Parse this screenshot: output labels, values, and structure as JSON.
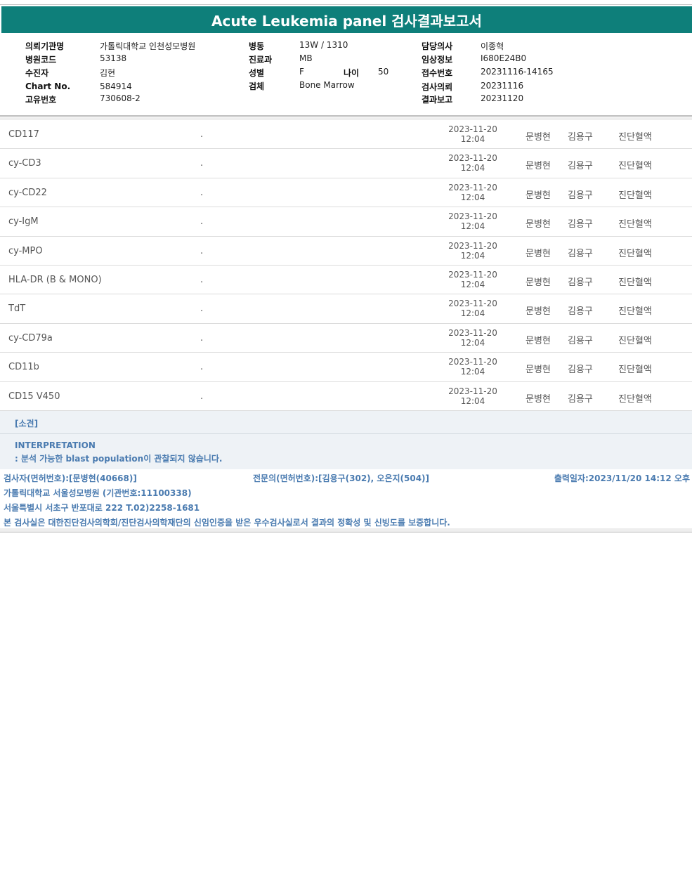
{
  "report": {
    "title": "Acute Leukemia panel 검사결과보고서"
  },
  "patient_info": {
    "institution_label": "의뢰기관명",
    "institution": "가톨릭대학교 인천성모병원",
    "hospital_code_label": "병원코드",
    "hospital_code": "53138",
    "patient_label": "수진자",
    "patient": "김현",
    "chart_no_label": "Chart No.",
    "chart_no": "584914",
    "unique_no_label": "고유번호",
    "unique_no": "730608-2",
    "ward_label": "병동",
    "ward": "13W / 1310",
    "department_label": "진료과",
    "department": "MB",
    "sex_label": "성별",
    "sex": "F",
    "age_label": "나이",
    "age": "50",
    "specimen_label": "검체",
    "specimen": "Bone Marrow",
    "doctor_label": "담당의사",
    "doctor": "이종혁",
    "clinical_info_label": "임상정보",
    "clinical_info": "I680E24B0",
    "receipt_no_label": "접수번호",
    "receipt_no": "20231116-14165",
    "request_date_label": "검사의뢰",
    "request_date": "20231116",
    "report_date_label": "결과보고",
    "report_date": "20231120"
  },
  "results": [
    {
      "name": "CD117",
      "value": ".",
      "date": "2023-11-20",
      "time": "12:04",
      "tester": "문병현",
      "specialist": "김용구",
      "dept": "진단혈액"
    },
    {
      "name": "cy-CD3",
      "value": ".",
      "date": "2023-11-20",
      "time": "12:04",
      "tester": "문병현",
      "specialist": "김용구",
      "dept": "진단혈액"
    },
    {
      "name": "cy-CD22",
      "value": ".",
      "date": "2023-11-20",
      "time": "12:04",
      "tester": "문병현",
      "specialist": "김용구",
      "dept": "진단혈액"
    },
    {
      "name": "cy-IgM",
      "value": ".",
      "date": "2023-11-20",
      "time": "12:04",
      "tester": "문병현",
      "specialist": "김용구",
      "dept": "진단혈액"
    },
    {
      "name": "cy-MPO",
      "value": ".",
      "date": "2023-11-20",
      "time": "12:04",
      "tester": "문병현",
      "specialist": "김용구",
      "dept": "진단혈액"
    },
    {
      "name": "HLA-DR (B & MONO)",
      "value": ".",
      "date": "2023-11-20",
      "time": "12:04",
      "tester": "문병현",
      "specialist": "김용구",
      "dept": "진단혈액"
    },
    {
      "name": "TdT",
      "value": ".",
      "date": "2023-11-20",
      "time": "12:04",
      "tester": "문병현",
      "specialist": "김용구",
      "dept": "진단혈액"
    },
    {
      "name": "cy-CD79a",
      "value": ".",
      "date": "2023-11-20",
      "time": "12:04",
      "tester": "문병현",
      "specialist": "김용구",
      "dept": "진단혈액"
    },
    {
      "name": "CD11b",
      "value": ".",
      "date": "2023-11-20",
      "time": "12:04",
      "tester": "문병현",
      "specialist": "김용구",
      "dept": "진단혈액"
    },
    {
      "name": "CD15 V450",
      "value": ".",
      "date": "2023-11-20",
      "time": "12:04",
      "tester": "문병현",
      "specialist": "김용구",
      "dept": "진단혈액"
    }
  ],
  "opinion": {
    "header": "[소견]",
    "interpretation_title": "INTERPRETATION",
    "interpretation_text": ": 분석 가능한 blast population이 관찰되지 않습니다."
  },
  "footer": {
    "tester": "검사자(면허번호):[문병현(40668)]",
    "specialist": "전문의(면허번호):[김용구(302), 오은지(504)]",
    "print_date": "출력일자:2023/11/20 14:12 오후",
    "institution": "가톨릭대학교 서울성모병원 (기관번호:11100338)",
    "address": "서울특별시 서초구 반포대로 222 T.02)2258-1681",
    "certification": "본 검사실은 대한진단검사의학회/진단검사의학재단의 신임인증을 받은 우수검사실로서 결과의 정확성 및 신빙도를 보증합니다."
  },
  "colors": {
    "title_bar": "#0e7f7a",
    "accent_text": "#4a7bb0",
    "opinion_bg": "#eef2f6"
  }
}
